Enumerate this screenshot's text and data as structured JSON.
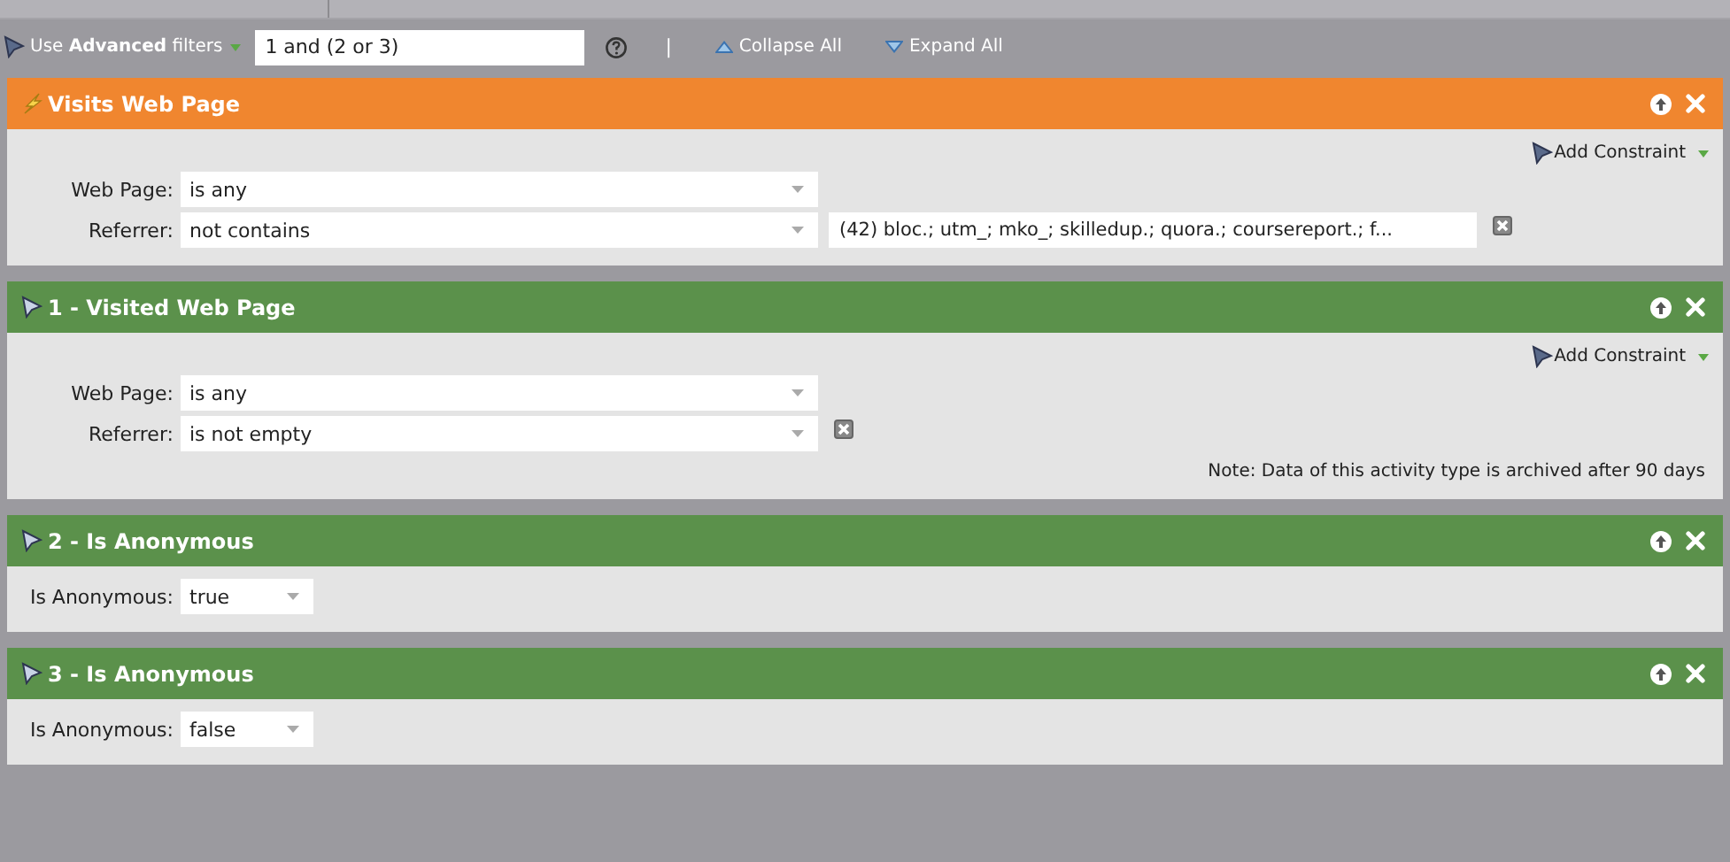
{
  "toolbar": {
    "advanced_label": "Use **Advanced** filters",
    "logic": "1 and (2 or 3)",
    "separator": "|",
    "collapse": "Collapse All",
    "expand": "Expand All"
  },
  "filters": [
    {
      "title": "Visits Web Page",
      "kind": "trigger",
      "color": "#f0862f",
      "add_constraint": "Add Constraint",
      "rows": [
        {
          "label": "Web Page:",
          "operator": "is any",
          "kind": "wide",
          "removable": false
        },
        {
          "label": "Referrer:",
          "operator": "not contains",
          "kind": "wide",
          "value": "(42) bloc.; utm_; mko_; skilledup.; quora.; coursereport.; f...",
          "removable": true
        }
      ]
    },
    {
      "title": "1 - Visited Web Page",
      "kind": "filter",
      "color": "#5b914b",
      "add_constraint": "Add Constraint",
      "rows": [
        {
          "label": "Web Page:",
          "operator": "is any",
          "kind": "wide",
          "removable": false
        },
        {
          "label": "Referrer:",
          "operator": "is not empty",
          "kind": "wide",
          "removable": true
        }
      ],
      "note": "Note: Data of this activity type is archived after 90 days"
    },
    {
      "title": "2 - Is Anonymous",
      "kind": "filter",
      "color": "#5b914b",
      "rows": [
        {
          "label": "Is Anonymous:",
          "operator": "true",
          "kind": "short",
          "removable": false
        }
      ]
    },
    {
      "title": "3 - Is Anonymous",
      "kind": "filter",
      "color": "#5b914b",
      "rows": [
        {
          "label": "Is Anonymous:",
          "operator": "false",
          "kind": "short",
          "removable": false
        }
      ]
    }
  ]
}
